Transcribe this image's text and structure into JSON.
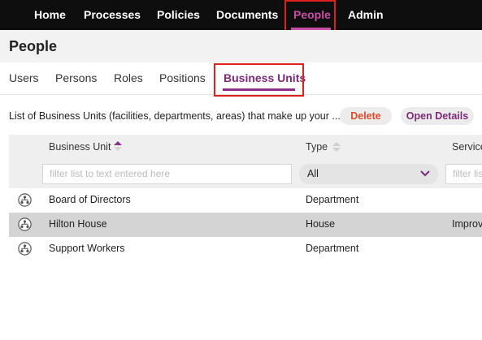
{
  "nav": {
    "items": [
      "Home",
      "Processes",
      "Policies",
      "Documents",
      "People",
      "Admin"
    ],
    "active": "People"
  },
  "page": {
    "title": "People"
  },
  "subtabs": {
    "items": [
      "Users",
      "Persons",
      "Roles",
      "Positions",
      "Business Units"
    ],
    "active": "Business Units"
  },
  "toolbar": {
    "description": "List of Business Units (facilities, departments, areas) that make up your ...",
    "delete_label": "Delete",
    "open_details_label": "Open Details"
  },
  "table": {
    "columns": [
      "Business Unit",
      "Type",
      "Service"
    ],
    "filters": {
      "business_unit_placeholder": "filter list to text entered here",
      "type_selected": "All",
      "service_placeholder": "filter list to text entered here"
    },
    "rows": [
      {
        "name": "Board of Directors",
        "type": "Department",
        "service": "",
        "selected": false
      },
      {
        "name": "Hilton House",
        "type": "House",
        "service": "Improv",
        "selected": true
      },
      {
        "name": "Support Workers",
        "type": "Department",
        "service": "",
        "selected": false
      }
    ]
  },
  "colors": {
    "accent": "#8a2e86",
    "nav_active": "#c94fa3",
    "highlight": "#e0201d",
    "delete": "#e04a2a"
  },
  "icons": {
    "row_icon": "org-chart-icon",
    "sort_icon": "sort-icon",
    "select_icon": "chevron-down-icon"
  }
}
